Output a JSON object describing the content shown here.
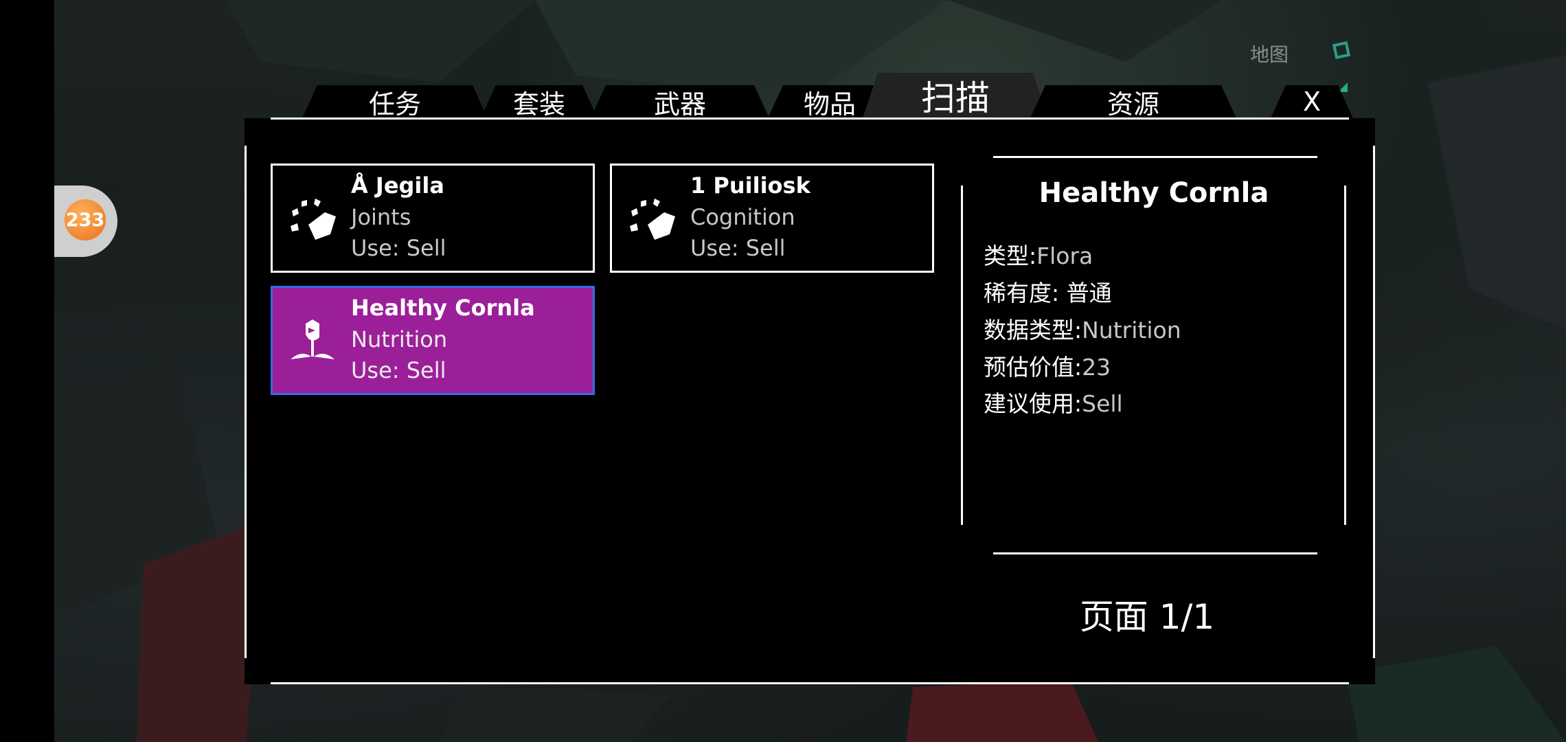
{
  "counter": {
    "value": "233"
  },
  "top_right": {
    "map_label": "地图",
    "map_icon": "map-square-icon"
  },
  "tabs": [
    {
      "label": "任务",
      "active": false
    },
    {
      "label": "套装",
      "active": false
    },
    {
      "label": "武器",
      "active": false
    },
    {
      "label": "物品",
      "active": false
    },
    {
      "label": "扫描",
      "active": true
    },
    {
      "label": "资源",
      "active": false
    },
    {
      "label": "X",
      "active": false
    }
  ],
  "items": [
    {
      "title": "Å Jegila",
      "category": "Joints",
      "use": "Use: Sell",
      "icon": "fragments-icon",
      "selected": false
    },
    {
      "title": "1 Puiliosk",
      "category": "Cognition",
      "use": "Use: Sell",
      "icon": "fragments-icon",
      "selected": false
    },
    {
      "title": "Healthy Cornla",
      "category": "Nutrition",
      "use": "Use: Sell",
      "icon": "flower-icon",
      "selected": true
    }
  ],
  "detail": {
    "title": "Healthy Cornla",
    "type_label": "类型:",
    "type_value": "Flora",
    "rarity_label": "稀有度:",
    "rarity_value": "普通",
    "datatype_label": "数据类型:",
    "datatype_value": "Nutrition",
    "value_label": "预估价值:",
    "value_value": "23",
    "usage_label": "建议使用:",
    "usage_value": "Sell"
  },
  "pagination": {
    "label": "页面 1/1"
  },
  "colors": {
    "selected_card": "#9c1f9a",
    "selected_border": "#2f6fe0",
    "badge": "#e8701e"
  }
}
